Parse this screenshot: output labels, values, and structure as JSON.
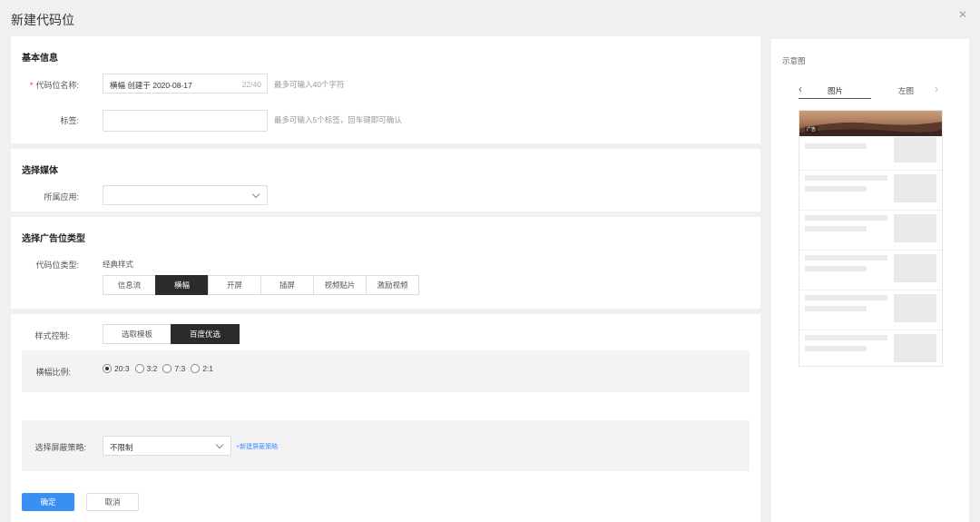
{
  "dialog": {
    "title": "新建代码位"
  },
  "basic": {
    "title": "基本信息",
    "name_label": "代码位名称:",
    "name_value": "横幅 创建于 2020-08-17",
    "name_count": "22/40",
    "name_hint": "最多可输入40个字符",
    "tag_label": "标签:",
    "tag_hint": "最多可输入5个标签，回车键即可确认"
  },
  "media": {
    "title": "选择媒体",
    "app_label": "所属应用:"
  },
  "adtype": {
    "title": "选择广告位类型",
    "type_label": "代码位类型:",
    "group_title": "经典样式",
    "types": [
      "信息流",
      "横幅",
      "开屏",
      "插屏",
      "视频贴片",
      "激励视频"
    ],
    "selected": "横幅"
  },
  "style": {
    "label": "样式控制:",
    "options": [
      "选取模板",
      "百度优选"
    ],
    "selected": "百度优选",
    "ratio_label": "横幅比例:",
    "ratios": [
      "20:3",
      "3:2",
      "7:3",
      "2:1"
    ],
    "ratio_selected": "20:3"
  },
  "block": {
    "label": "选择屏蔽策略:",
    "value": "不限制",
    "link": "+新建屏蔽策略"
  },
  "actions": {
    "confirm": "确定",
    "cancel": "取消"
  },
  "preview": {
    "title": "示意图",
    "tabs": [
      "图片",
      "左图"
    ],
    "active_tab": "图片",
    "banner_badge": "广告"
  }
}
